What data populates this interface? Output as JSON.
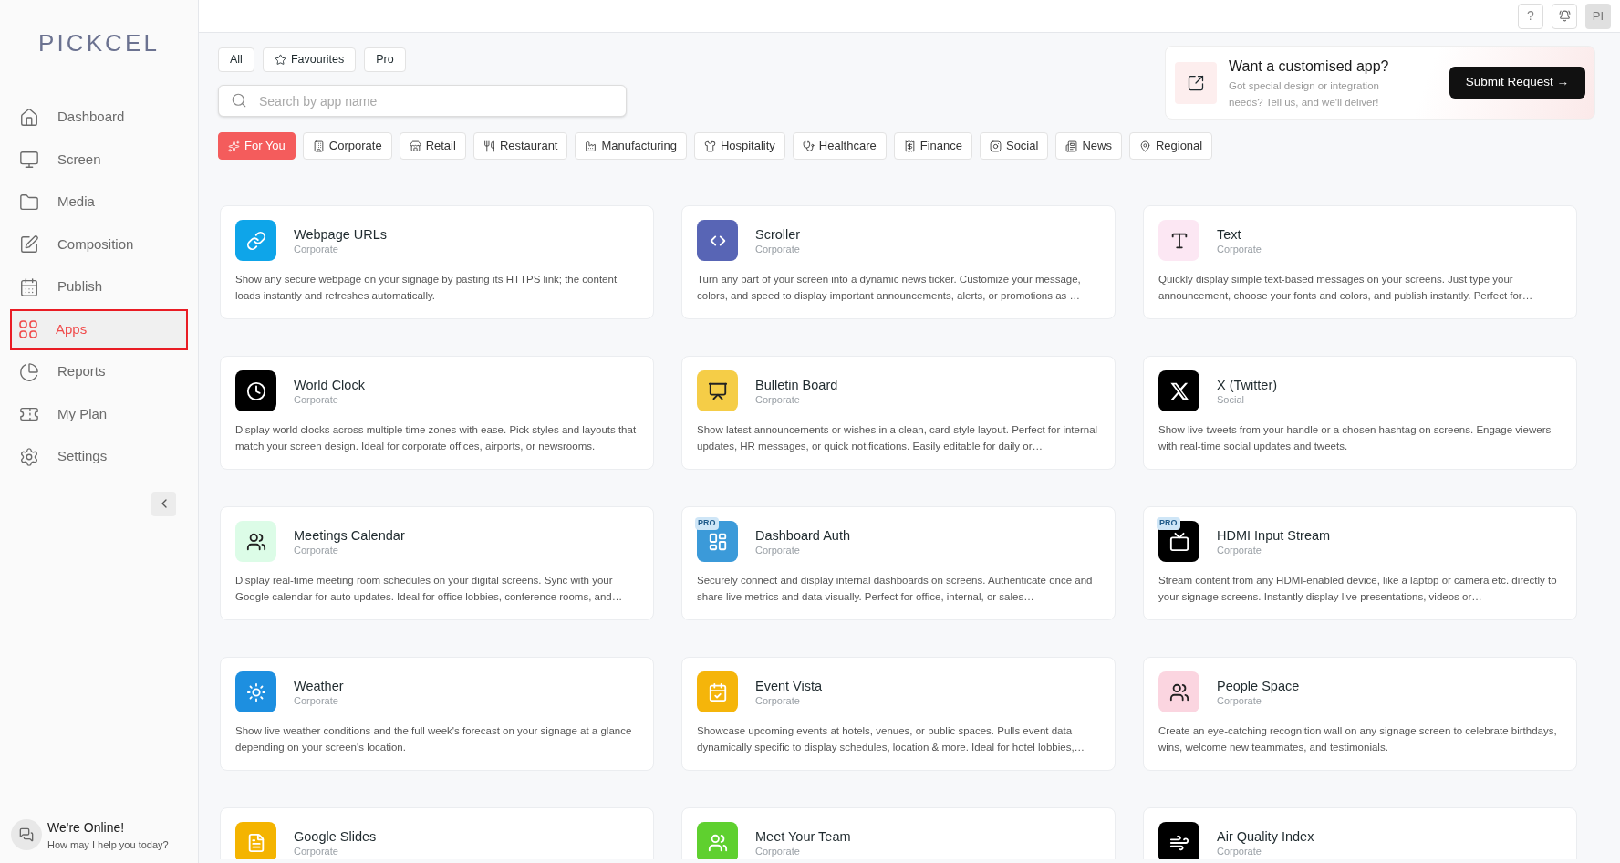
{
  "logo": "PICKCEL",
  "sidebar": {
    "items": [
      {
        "label": "Dashboard",
        "selected": false
      },
      {
        "label": "Screen",
        "selected": false
      },
      {
        "label": "Media",
        "selected": false
      },
      {
        "label": "Composition",
        "selected": false
      },
      {
        "label": "Publish",
        "selected": false
      },
      {
        "label": "Apps",
        "selected": true
      },
      {
        "label": "Reports",
        "selected": false
      },
      {
        "label": "My Plan",
        "selected": false
      },
      {
        "label": "Settings",
        "selected": false
      }
    ]
  },
  "chat": {
    "title": "We're Online!",
    "subtitle": "How may I help you today?"
  },
  "topbar": {
    "help": "?",
    "avatar": "PI"
  },
  "filters": [
    "All",
    "Favourites",
    "Pro"
  ],
  "search": {
    "placeholder": "Search by app name"
  },
  "banner": {
    "title": "Want a customised app?",
    "text": "Got special design or integration needs? Tell us, and we'll deliver!",
    "button": "Submit Request →"
  },
  "categories": [
    {
      "label": "For You",
      "selected": true
    },
    {
      "label": "Corporate",
      "selected": false
    },
    {
      "label": "Retail",
      "selected": false
    },
    {
      "label": "Restaurant",
      "selected": false
    },
    {
      "label": "Manufacturing",
      "selected": false
    },
    {
      "label": "Hospitality",
      "selected": false
    },
    {
      "label": "Healthcare",
      "selected": false
    },
    {
      "label": "Finance",
      "selected": false
    },
    {
      "label": "Social",
      "selected": false
    },
    {
      "label": "News",
      "selected": false
    },
    {
      "label": "Regional",
      "selected": false
    }
  ],
  "apps": [
    {
      "name": "Webpage URLs",
      "category": "Corporate",
      "color": "#0ea5e9",
      "description": "Show any secure webpage on your signage by pasting its HTTPS link; the content loads instantly and refreshes automatically."
    },
    {
      "name": "Scroller",
      "category": "Corporate",
      "color": "#5865b5",
      "description": "Turn any part of your screen into a dynamic news ticker. Customize your message, colors, and speed to display important announcements, alerts, or promotions as …"
    },
    {
      "name": "Text",
      "category": "Corporate",
      "color": "#fce7f3",
      "description": "Quickly display simple text-based messages on your screens. Just type your announcement, choose your fonts and colors, and publish instantly. Perfect for…"
    },
    {
      "name": "World Clock",
      "category": "Corporate",
      "color": "#000000",
      "description": "Display world clocks across multiple time zones with ease. Pick styles and layouts that match your screen design. Ideal for corporate offices, airports, or newsrooms."
    },
    {
      "name": "Bulletin Board",
      "category": "Corporate",
      "color": "#f5cd47",
      "description": "Show latest announcements or wishes in a clean, card-style layout. Perfect for internal updates, HR messages, or quick notifications. Easily editable for daily or…"
    },
    {
      "name": "X (Twitter)",
      "category": "Social",
      "color": "#000000",
      "description": "Show live tweets from your handle or a chosen hashtag on screens. Engage viewers with real-time social updates and tweets."
    },
    {
      "name": "Meetings Calendar",
      "category": "Corporate",
      "color": "#dcfce7",
      "description": "Display real-time meeting room schedules on your digital screens. Sync with your Google calendar for auto updates. Ideal for office lobbies, conference rooms, and…"
    },
    {
      "name": "Dashboard Auth",
      "category": "Corporate",
      "color": "#3b9ad9",
      "badge": "PRO",
      "description": "Securely connect and display internal dashboards on screens. Authenticate once and share live metrics and data visually. Perfect for office, internal, or sales…"
    },
    {
      "name": "HDMI Input Stream",
      "category": "Corporate",
      "color": "#000000",
      "badge": "PRO",
      "description": "Stream content from any HDMI-enabled device, like a laptop or camera etc. directly to your signage screens. Instantly display live presentations, videos or…"
    },
    {
      "name": "Weather",
      "category": "Corporate",
      "color": "#1d8fe0",
      "description": "Show live weather conditions and the full week's forecast on your signage at a glance depending on your screen's location."
    },
    {
      "name": "Event Vista",
      "category": "Corporate",
      "color": "#f5b50a",
      "description": "Showcase upcoming events at hotels, venues, or public spaces. Pulls event data dynamically specific to display schedules, location & more. Ideal for hotel lobbies,…"
    },
    {
      "name": "People Space",
      "category": "Corporate",
      "color": "#fbd5e0",
      "description": "Create an eye-catching recognition wall on any signage screen to celebrate birthdays, wins, welcome new teammates, and testimonials."
    },
    {
      "name": "Google Slides",
      "category": "Corporate",
      "color": "#f4b400"
    },
    {
      "name": "Meet Your Team",
      "category": "Corporate",
      "color": "#5fd02f"
    },
    {
      "name": "Air Quality Index",
      "category": "Corporate",
      "color": "#000000"
    }
  ]
}
